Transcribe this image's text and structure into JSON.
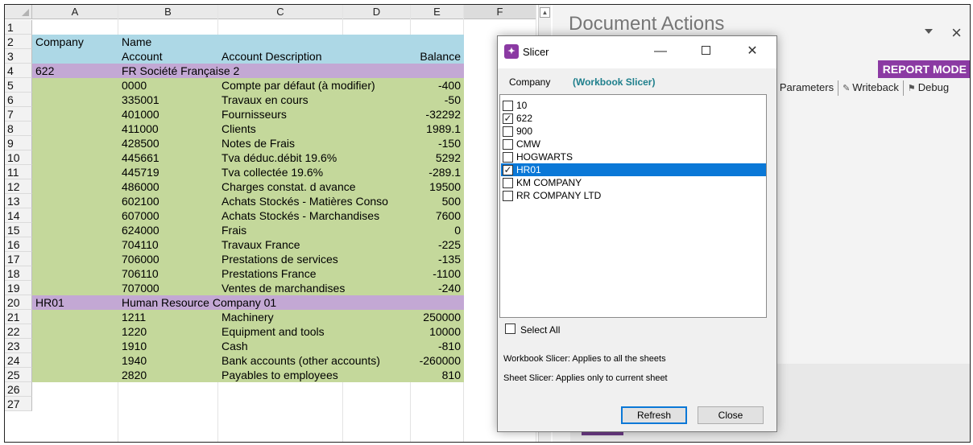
{
  "sheet": {
    "columns": [
      "A",
      "B",
      "C",
      "D",
      "E",
      "F"
    ],
    "selected_column": "F",
    "rows": [
      {
        "n": "1",
        "style": "",
        "a": "",
        "b": "",
        "c": "",
        "e": ""
      },
      {
        "n": "2",
        "style": "blue",
        "a": "Company",
        "b": "Name",
        "c": "",
        "e": ""
      },
      {
        "n": "3",
        "style": "blue",
        "a": "",
        "b": "Account",
        "c": "Account Description",
        "e": "Balance"
      },
      {
        "n": "4",
        "style": "purple",
        "a": "622",
        "b": "FR Société Française 2",
        "c": "",
        "e": ""
      },
      {
        "n": "5",
        "style": "green",
        "a": "",
        "b": "0000",
        "c": "Compte par défaut (à modifier)",
        "e": "-400"
      },
      {
        "n": "6",
        "style": "green",
        "a": "",
        "b": "335001",
        "c": "Travaux en cours",
        "e": "-50"
      },
      {
        "n": "7",
        "style": "green",
        "a": "",
        "b": "401000",
        "c": "Fournisseurs",
        "e": "-32292"
      },
      {
        "n": "8",
        "style": "green",
        "a": "",
        "b": "411000",
        "c": "Clients",
        "e": "1989.1"
      },
      {
        "n": "9",
        "style": "green",
        "a": "",
        "b": "428500",
        "c": "Notes de Frais",
        "e": "-150"
      },
      {
        "n": "10",
        "style": "green",
        "a": "",
        "b": "445661",
        "c": "Tva déduc.débit 19.6%",
        "e": "5292"
      },
      {
        "n": "11",
        "style": "green",
        "a": "",
        "b": "445719",
        "c": "Tva collectée 19.6%",
        "e": "-289.1"
      },
      {
        "n": "12",
        "style": "green",
        "a": "",
        "b": "486000",
        "c": "Charges constat. d avance",
        "e": "19500"
      },
      {
        "n": "13",
        "style": "green",
        "a": "",
        "b": "602100",
        "c": "Achats Stockés - Matières Conso",
        "e": "500"
      },
      {
        "n": "14",
        "style": "green",
        "a": "",
        "b": "607000",
        "c": "Achats Stockés - Marchandises",
        "e": "7600"
      },
      {
        "n": "15",
        "style": "green",
        "a": "",
        "b": "624000",
        "c": "Frais",
        "e": "0"
      },
      {
        "n": "16",
        "style": "green",
        "a": "",
        "b": "704110",
        "c": "Travaux France",
        "e": "-225"
      },
      {
        "n": "17",
        "style": "green",
        "a": "",
        "b": "706000",
        "c": "Prestations de services",
        "e": "-135"
      },
      {
        "n": "18",
        "style": "green",
        "a": "",
        "b": "706110",
        "c": "Prestations France",
        "e": "-1100"
      },
      {
        "n": "19",
        "style": "green",
        "a": "",
        "b": "707000",
        "c": "Ventes de marchandises",
        "e": "-240"
      },
      {
        "n": "20",
        "style": "purple",
        "a": "HR01",
        "b": "Human Resource Company 01",
        "c": "",
        "e": ""
      },
      {
        "n": "21",
        "style": "green",
        "a": "",
        "b": "1211",
        "c": "Machinery",
        "e": "250000"
      },
      {
        "n": "22",
        "style": "green",
        "a": "",
        "b": "1220",
        "c": "Equipment and tools",
        "e": "10000"
      },
      {
        "n": "23",
        "style": "green",
        "a": "",
        "b": "1910",
        "c": "Cash",
        "e": "-810"
      },
      {
        "n": "24",
        "style": "green",
        "a": "",
        "b": "1940",
        "c": "Bank accounts (other accounts)",
        "e": "-260000"
      },
      {
        "n": "25",
        "style": "green",
        "a": "",
        "b": "2820",
        "c": "Payables to employees",
        "e": "810"
      },
      {
        "n": "26",
        "style": "",
        "a": "",
        "b": "",
        "c": "",
        "e": ""
      },
      {
        "n": "27",
        "style": "",
        "a": "",
        "b": "",
        "c": "",
        "e": ""
      }
    ]
  },
  "pane": {
    "title": "Document Actions",
    "report_mode": "REPORT MODE",
    "tabs": [
      {
        "label": "Parameters",
        "icon": "parameters-icon"
      },
      {
        "label": "Writeback",
        "icon": "writeback-icon"
      },
      {
        "label": "Debug",
        "icon": "debug-icon"
      }
    ],
    "close": "×"
  },
  "slicer": {
    "title": "Slicer",
    "window_buttons": {
      "minimize": "—",
      "close": "✕"
    },
    "header_company": "Company",
    "header_slicer": "(Workbook Slicer)",
    "items": [
      {
        "label": "10",
        "checked": false,
        "selected": false
      },
      {
        "label": "622",
        "checked": true,
        "selected": false
      },
      {
        "label": "900",
        "checked": false,
        "selected": false
      },
      {
        "label": "CMW",
        "checked": false,
        "selected": false
      },
      {
        "label": "HOGWARTS",
        "checked": false,
        "selected": false
      },
      {
        "label": "HR01",
        "checked": true,
        "selected": true
      },
      {
        "label": "KM COMPANY",
        "checked": false,
        "selected": false
      },
      {
        "label": "RR COMPANY LTD",
        "checked": false,
        "selected": false
      }
    ],
    "select_all": "Select All",
    "select_all_checked": false,
    "note1": "Workbook Slicer: Applies to all the sheets",
    "note2": "Sheet Slicer: Applies only to current sheet",
    "refresh_label": "Refresh",
    "close_label": "Close"
  },
  "colors": {
    "header_band": "#add8e6",
    "company_band": "#c3a8d4",
    "account_band": "#c4d89b",
    "accent": "#8b3aa3",
    "selection": "#0a78d7"
  }
}
